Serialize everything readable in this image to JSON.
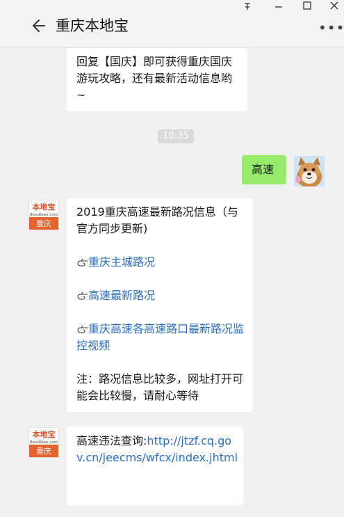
{
  "window": {
    "pin_icon": "pin-icon",
    "minimize_icon": "minimize-icon",
    "maximize_icon": "maximize-icon",
    "close_icon": "close-icon"
  },
  "header": {
    "title": "重庆本地宝",
    "more_label": "•••"
  },
  "messages": {
    "m1_text": "回复【国庆】即可获得重庆国庆游玩攻略，还有最新活动信息哟~",
    "time": "10:35",
    "user_text": "高速",
    "m2_line1": "2019重庆高速最新路况信息（与官方同步更新)",
    "m2_link1": "重庆主城路况",
    "m2_link2": "高速最新路况",
    "m2_link3": "重庆高速各高速路口最新路况监控视频",
    "m2_note": "注：路况信息比较多，网址打开可能会比较慢，请耐心等待",
    "m3_prefix": "高速违法查询:",
    "m3_link": "http://jtzf.cq.gov.cn/jeecms/wfcx/index.jhtml"
  },
  "brand": {
    "name": "本地宝",
    "domain": "Bendibao.com",
    "city": "重庆"
  },
  "colors": {
    "link": "#2a6fc9",
    "user_bubble": "#95ec69",
    "brand_orange": "#e8622f"
  }
}
